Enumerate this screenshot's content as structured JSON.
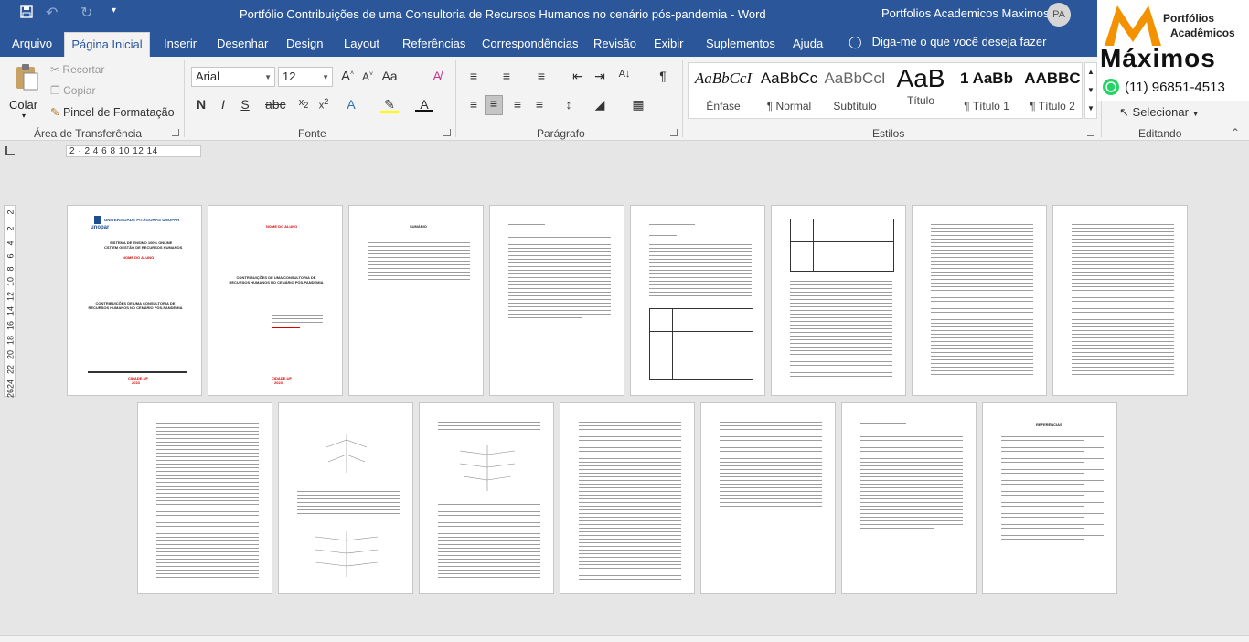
{
  "titlebar": {
    "title": "Portfólio Contribuições de uma Consultoria de Recursos Humanos no cenário pós-pandemia  -  Word",
    "user": "Portfolios Academicos Maximos",
    "initials": "PA"
  },
  "menu": {
    "file": "Arquivo",
    "home": "Página Inicial",
    "insert": "Inserir",
    "draw": "Desenhar",
    "design": "Design",
    "layout": "Layout",
    "references": "Referências",
    "mailings": "Correspondências",
    "review": "Revisão",
    "view": "Exibir",
    "addins": "Suplementos",
    "help": "Ajuda",
    "tellme": "Diga-me o que você deseja fazer"
  },
  "ribbon": {
    "clipboard": {
      "paste": "Colar",
      "cut": "Recortar",
      "copy": "Copiar",
      "format_painter": "Pincel de Formatação",
      "label": "Área de Transferência"
    },
    "font": {
      "name": "Arial",
      "size": "12",
      "label": "Fonte"
    },
    "paragraph": {
      "label": "Parágrafo"
    },
    "styles": {
      "label": "Estilos",
      "items": [
        {
          "sample": "AaBbCcI",
          "name": "Ênfase"
        },
        {
          "sample": "AaBbCc",
          "name": "¶ Normal"
        },
        {
          "sample": "AaBbCcI",
          "name": "Subtítulo"
        },
        {
          "sample": "AaB",
          "name": "Título"
        },
        {
          "sample": "1 AaBb",
          "name": "¶ Título 1"
        },
        {
          "sample": "AABBC",
          "name": "¶ Título 2"
        }
      ]
    },
    "editing": {
      "select": "Selecionar",
      "label": "Editando"
    }
  },
  "ruler": {
    "marks": "2 · 2 4 6 8 10 12 14",
    "vertical": [
      "2",
      "2",
      "4",
      "6",
      "8",
      "10",
      "12",
      "14",
      "16",
      "18",
      "20",
      "22",
      "24",
      "26"
    ]
  },
  "logo": {
    "line1": "Portfólios",
    "line2": "Acadêmicos",
    "brand": "Máximos",
    "phone": "(11) 96851-4513"
  },
  "pages": {
    "cover_university": "UNIVERSIDADE PITÁGORAS UNOPAR",
    "cover_brand": "unopar",
    "cover_system": "SISTEMA DE ENSINO 100% ONLINE",
    "cover_course": "CST EM GESTÃO DE RECURSOS HUMANOS",
    "cover_author": "NOME DO ALUNO",
    "cover_title": "CONTRIBUIÇÕES DE UMA CONSULTORIA DE RECURSOS HUMANOS NO CENÁRIO PÓS-PANDEMIA",
    "cover_city": "CIDADE-UF",
    "cover_year": "2023",
    "toc_title": "SUMÁRIO",
    "ref_title": "REFERÊNCIAS"
  }
}
